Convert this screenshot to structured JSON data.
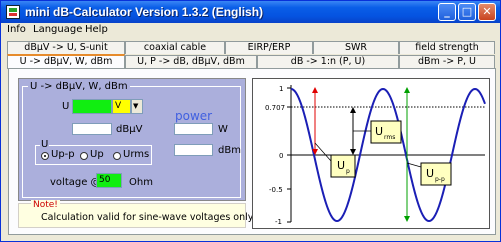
{
  "window": {
    "title": "mini dB-Calculator Version 1.3.2 (English)"
  },
  "titlebar_buttons": {
    "minimize": "_",
    "maximize": "□",
    "close": "✕"
  },
  "menu": [
    {
      "label": "Info"
    },
    {
      "label": "Language"
    },
    {
      "label": "Help"
    }
  ],
  "tabs_row1": [
    "dBµV -> U, S-unit",
    "coaxial cable",
    "EIRP/ERP",
    "SWR",
    "field strength"
  ],
  "tabs_row2": [
    "U -> dBµV, W, dBm",
    "U, P -> dB, dBµV, dBm",
    "dB -> 1:n (P, U)",
    "dBm -> P, U"
  ],
  "active_tab": "U -> dBµV, W, dBm",
  "group_title": "U -> dBµV, W, dBm",
  "input": {
    "label": "U",
    "value": "",
    "unit": "V",
    "unit_arrow": "▼",
    "accent": "#11ee11",
    "unit_color": "#ffff00"
  },
  "dbuv": {
    "value": "",
    "unit": "dBµV"
  },
  "power": {
    "heading": "power",
    "w_value": "",
    "w_unit": "W",
    "dbm_value": "",
    "dbm_unit": "dBm"
  },
  "u_group": {
    "title": "U",
    "options": [
      "Up-p",
      "Up",
      "Urms"
    ],
    "selected": "Up-p"
  },
  "voltage": {
    "label": "voltage @",
    "value": "50",
    "unit": "Ohm"
  },
  "note": {
    "title": "Note!",
    "text": "Calculation valid for sine-wave voltages only!"
  },
  "graph": {
    "tick_labels": [
      "1",
      "0.707",
      "0",
      "-0.5",
      "-1"
    ],
    "labels": {
      "urms": "U",
      "urms_sub": "rms",
      "up": "U",
      "up_sub": "p",
      "upp": "U",
      "upp_sub": "p-p"
    }
  }
}
